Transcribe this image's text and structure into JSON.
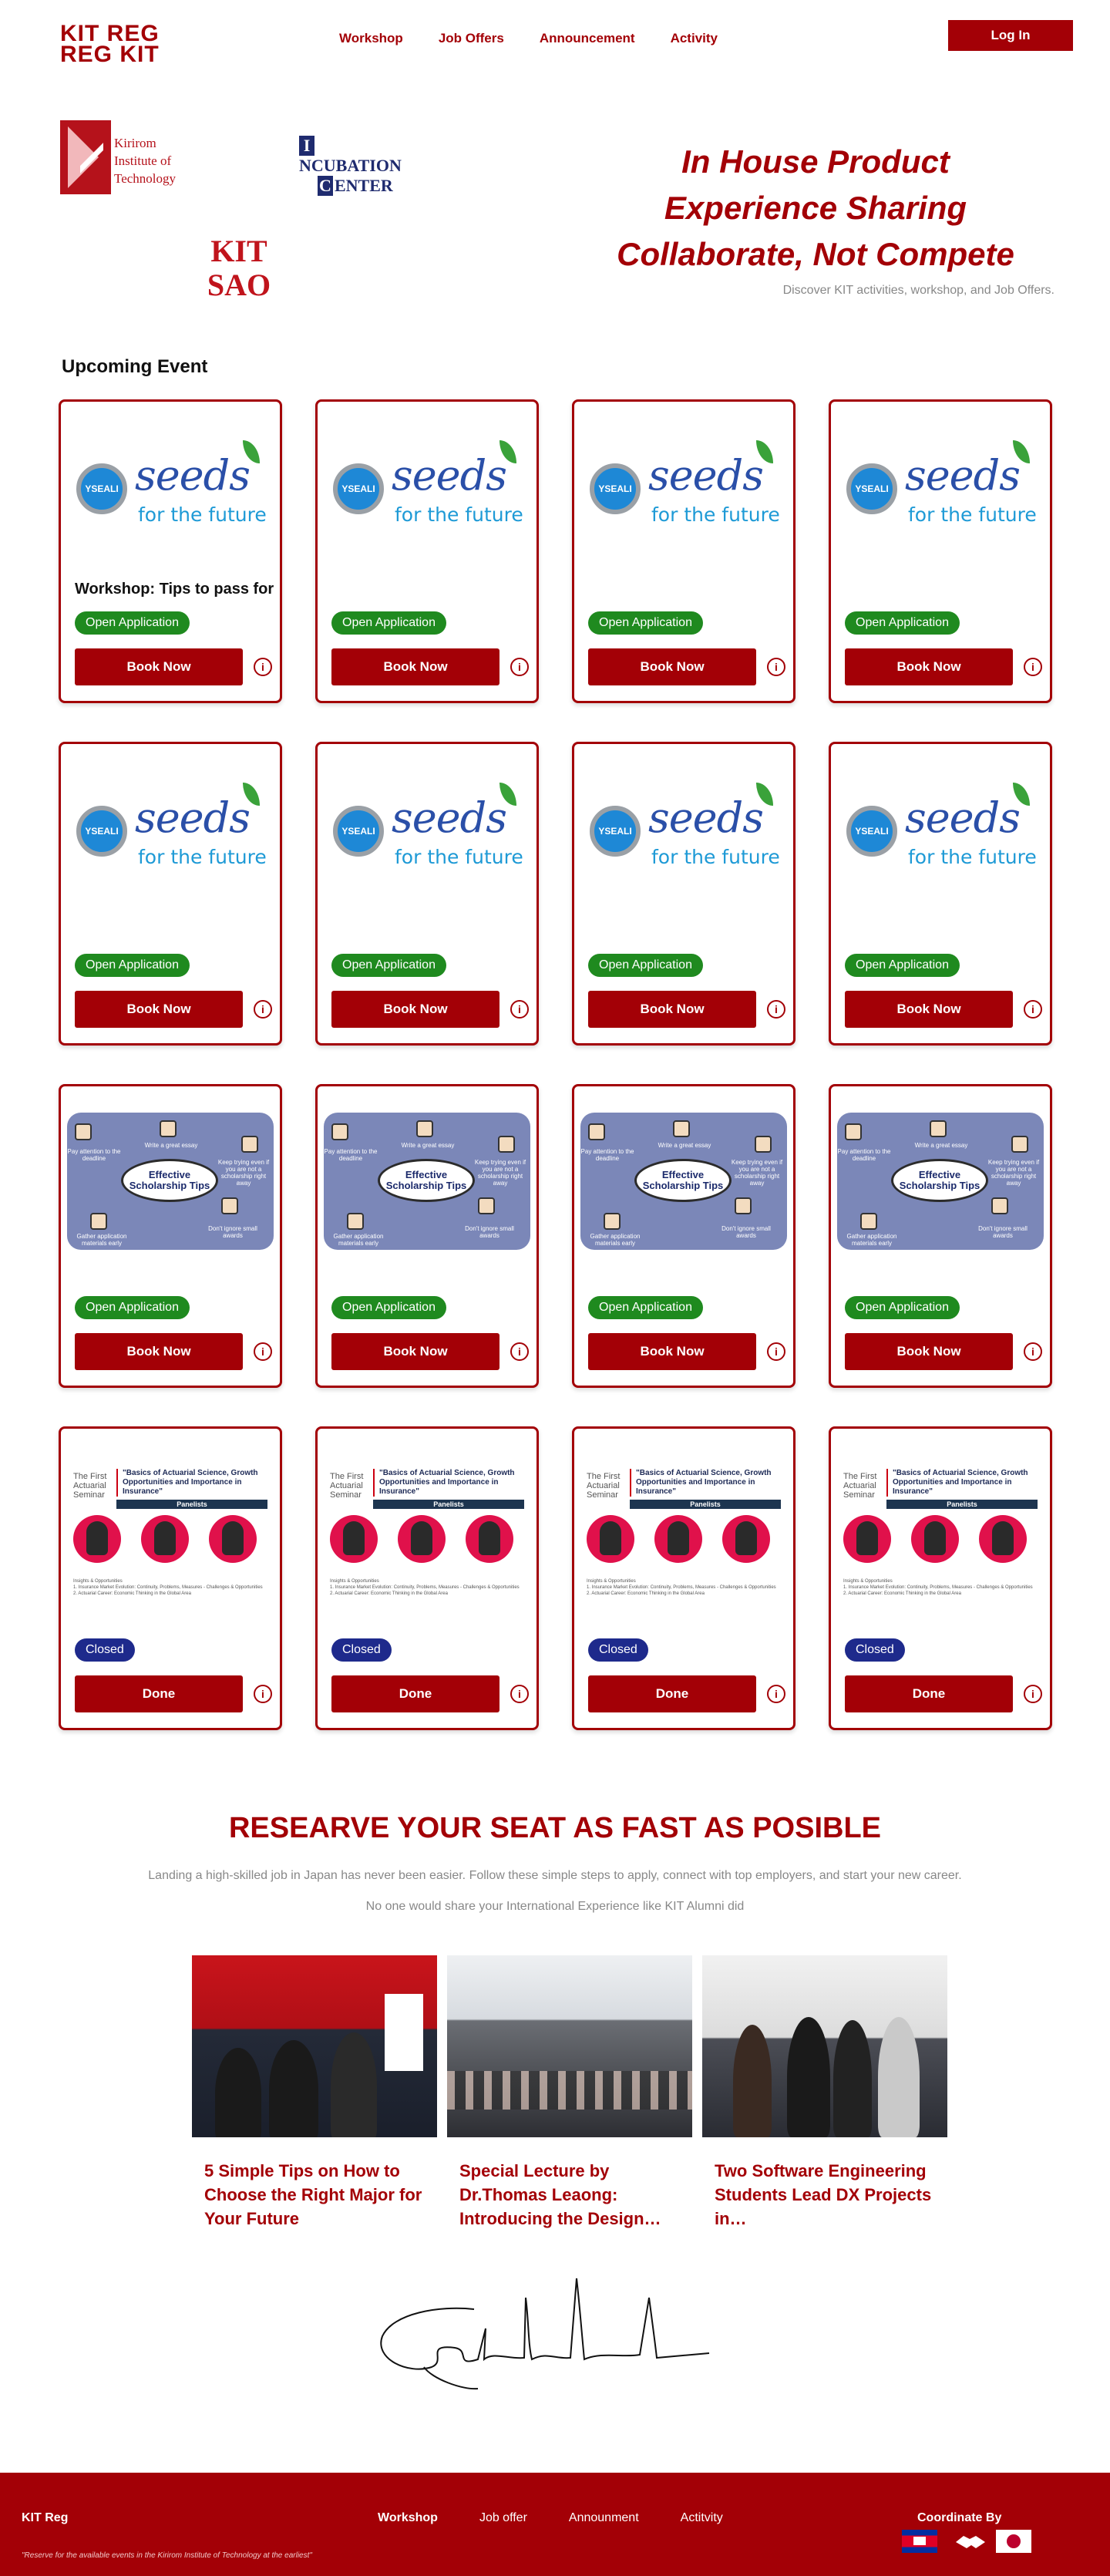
{
  "header": {
    "logo_top": "KIT REG",
    "logo_bottom": "REG KIT",
    "nav": [
      "Workshop",
      "Job Offers",
      "Announcement",
      "Activity"
    ],
    "login_label": "Log In"
  },
  "hero": {
    "partner_kit": [
      "Kirirom",
      "Institute of",
      "Technology"
    ],
    "partner_incubation": [
      "NCUBATION",
      "ENTER"
    ],
    "partner_kitsao": [
      "KIT",
      "SAO"
    ],
    "title_lines": [
      "In House Product",
      "Experience Sharing",
      "Collaborate, Not Compete"
    ],
    "subtitle": "Discover KIT activities, workshop, and Job Offers."
  },
  "events": {
    "section_title": "Upcoming Event",
    "cards": [
      {
        "image": "seeds",
        "title": "Workshop: Tips to pass for",
        "status": "Open Application",
        "status_type": "open",
        "action": "Book Now"
      },
      {
        "image": "seeds",
        "title": "",
        "status": "Open Application",
        "status_type": "open",
        "action": "Book Now"
      },
      {
        "image": "seeds",
        "title": "",
        "status": "Open Application",
        "status_type": "open",
        "action": "Book Now"
      },
      {
        "image": "seeds",
        "title": "",
        "status": "Open Application",
        "status_type": "open",
        "action": "Book Now"
      },
      {
        "image": "seeds",
        "title": "",
        "status": "Open Application",
        "status_type": "open",
        "action": "Book Now"
      },
      {
        "image": "seeds",
        "title": "",
        "status": "Open Application",
        "status_type": "open",
        "action": "Book Now"
      },
      {
        "image": "seeds",
        "title": "",
        "status": "Open Application",
        "status_type": "open",
        "action": "Book Now"
      },
      {
        "image": "seeds",
        "title": "",
        "status": "Open Application",
        "status_type": "open",
        "action": "Book Now"
      },
      {
        "image": "scholarship",
        "title": "",
        "status": "Open Application",
        "status_type": "open",
        "action": "Book Now"
      },
      {
        "image": "scholarship",
        "title": "",
        "status": "Open Application",
        "status_type": "open",
        "action": "Book Now"
      },
      {
        "image": "scholarship",
        "title": "",
        "status": "Open Application",
        "status_type": "open",
        "action": "Book Now"
      },
      {
        "image": "scholarship",
        "title": "",
        "status": "Open Application",
        "status_type": "open",
        "action": "Book Now"
      },
      {
        "image": "seminar",
        "title": "",
        "status": "Closed",
        "status_type": "closed",
        "action": "Done"
      },
      {
        "image": "seminar",
        "title": "",
        "status": "Closed",
        "status_type": "closed",
        "action": "Done"
      },
      {
        "image": "seminar",
        "title": "",
        "status": "Closed",
        "status_type": "closed",
        "action": "Done"
      },
      {
        "image": "seminar",
        "title": "",
        "status": "Closed",
        "status_type": "closed",
        "action": "Done"
      }
    ],
    "info_glyph": "i"
  },
  "seeds_image": {
    "badge": "YSEALI",
    "word": "seeds",
    "tagline": "for the future"
  },
  "scholarship_image": {
    "center": "Effective Scholarship Tips",
    "labels": [
      "Pay attention to the deadline",
      "Write a great essay",
      "Keep trying even if you are not a scholarship right away",
      "Gather application materials early",
      "Don't ignore small awards"
    ]
  },
  "seminar_image": {
    "left": "The First Actuarial Seminar",
    "title": "\"Basics of Actuarial Science, Growth Opportunities and Importance in Insurance\"",
    "panel": "Panelists",
    "footer": [
      "Insights & Opportunities",
      "1. Insurance Market Evolution: Continuity, Problems, Measures - Challenges & Opportunities",
      "2. Actuarial Career: Economic Thinking in the Global Area"
    ]
  },
  "reserve": {
    "title": "RESEARVE YOUR SEAT AS FAST AS POSIBLE",
    "p1": "Landing a high-skilled job in Japan has never been easier. Follow these simple steps to apply, connect with top employers, and start your new career.",
    "p2": "No one would share your International Experience like KIT Alumni did",
    "news": [
      {
        "headline": "5 Simple Tips on How to Choose the Right Major for Your Future"
      },
      {
        "headline": "Special Lecture by Dr.Thomas Leaong: Introducing the Design…"
      },
      {
        "headline": "Two Software Engineering Students Lead DX Projects in…"
      }
    ]
  },
  "footer": {
    "brand": "KIT Reg",
    "note": "\"Reserve for the available events in the Kirirom Institute of Technology at the earliest\"",
    "nav": [
      "Workshop",
      "Job offer",
      "Announment",
      "Actitvity"
    ],
    "coordinate": "Coordinate By"
  },
  "colors": {
    "brand_red": "#a30006",
    "open_green": "#1f8a1f",
    "closed_blue": "#1e2a8c"
  }
}
